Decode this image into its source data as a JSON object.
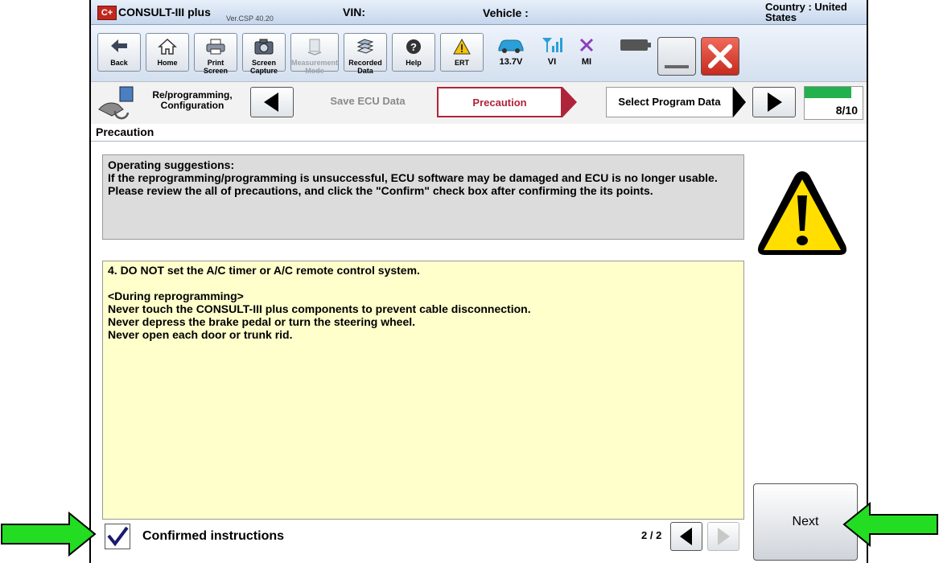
{
  "titlebar": {
    "logo": "C+",
    "app_title": "CONSULT-III plus",
    "app_version": "Ver.CSP 40.20",
    "vin_label": "VIN:",
    "vehicle_label": "Vehicle :",
    "country_label": "Country : United States"
  },
  "toolbar": {
    "back_label": "Back",
    "home_label": "Home",
    "print_label": "Print Screen",
    "capture_label": "Screen Capture",
    "measurement_label": "Measurement Mode",
    "recorded_label": "Recorded Data",
    "help_label": "Help",
    "ert_label": "ERT",
    "voltage_label": "13.7V",
    "vi_label": "VI",
    "mi_label": "MI"
  },
  "navbar": {
    "flow_label": "Re/programming, Configuration",
    "steps": [
      {
        "label": "Save ECU Data",
        "state": "done"
      },
      {
        "label": "Precaution",
        "state": "current"
      },
      {
        "label": "Select Program Data",
        "state": "next"
      }
    ],
    "progress_text": "8/10",
    "progress_fraction": 0.8
  },
  "page_header": "Precaution",
  "suggestion": {
    "heading": "Operating suggestions:",
    "line1": "If the reprogramming/programming is unsuccessful, ECU software may be damaged and ECU is no longer usable.",
    "line2": "Please review the all of precautions, and click the \"Confirm\" check box after confirming the its points."
  },
  "precaution": {
    "item": "4. DO NOT set the A/C timer or A/C remote control system.",
    "section": "<During reprogramming>",
    "lines": [
      "Never touch the CONSULT-III plus components to prevent cable disconnection.",
      "Never depress the brake pedal or turn the steering wheel.",
      "Never open each door or trunk rid."
    ]
  },
  "confirm": {
    "label": "Confirmed instructions",
    "checked": true
  },
  "pagination": {
    "text": "2 / 2"
  },
  "next_label": "Next",
  "colors": {
    "accent_red": "#c0281e",
    "progress_green": "#22b14c",
    "callout_green": "#22dd22",
    "current_step_border": "#b0243a"
  }
}
